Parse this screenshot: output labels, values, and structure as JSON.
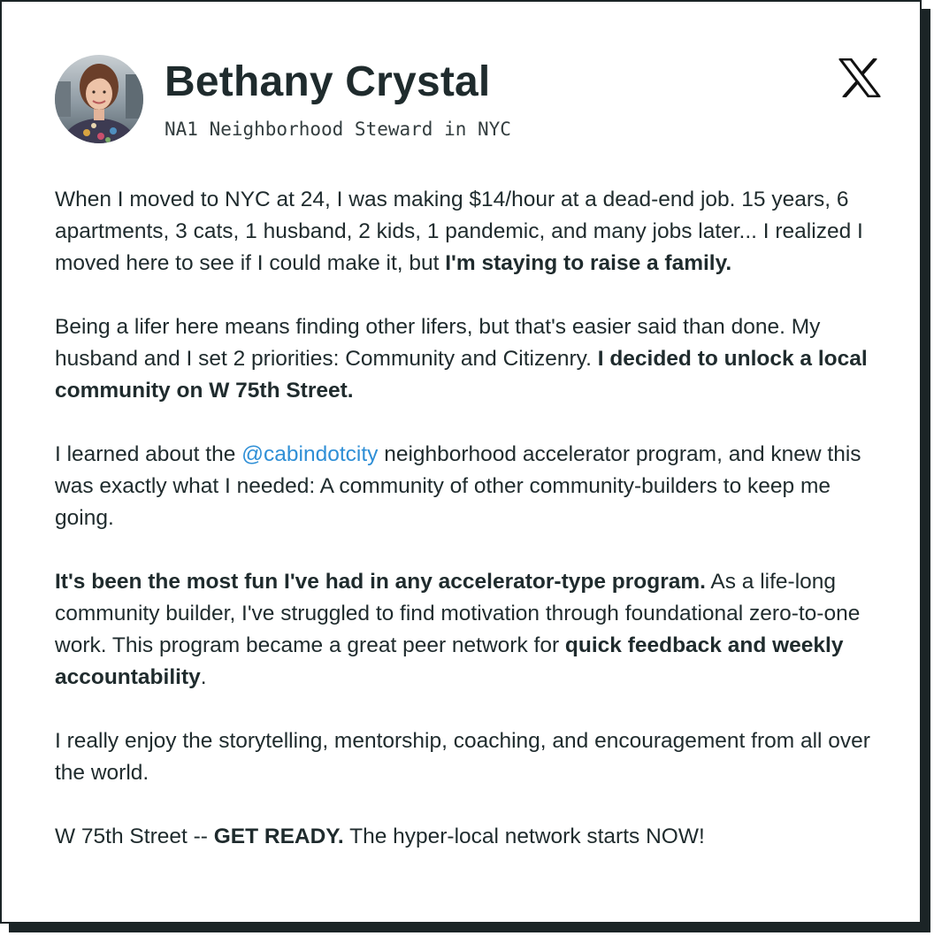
{
  "profile": {
    "name": "Bethany Crystal",
    "subtitle": "NA1 Neighborhood Steward in NYC",
    "avatar_icon": "profile-photo",
    "source_icon": "x-logo-icon"
  },
  "colors": {
    "text": "#1f2b2d",
    "mention": "#2f8fd6",
    "border": "#1b2426"
  },
  "testimonial": {
    "p1": {
      "t1": "When I moved to NYC at 24, I was making $14/hour at a dead-end job. 15 years, 6 apartments, 3 cats, 1 husband, 2 kids, 1 pandemic, and many jobs later... I realized I moved here to see if I could make it, but ",
      "b1": "I'm staying to raise a family."
    },
    "p2": {
      "t1": "Being a lifer here means finding other lifers, but that's easier said than done. My husband and I set 2 priorities: Community and Citizenry. ",
      "b1": "I decided to unlock a local community on W 75th Street."
    },
    "p3": {
      "t1": "I learned about the ",
      "mention": "@cabindotcity",
      "t2": " neighborhood accelerator program, and knew this was exactly what I needed: A community of other community-builders to keep me going."
    },
    "p4": {
      "b1": "It's been the most fun I've had in any accelerator-type program.",
      "t1": " As a life-long community builder, I've struggled to find motivation through foundational zero-to-one work. This program became a great peer network for ",
      "b2": "quick feedback and weekly accountability",
      "t2": "."
    },
    "p5": {
      "t1": "I really enjoy the storytelling, mentorship, coaching, and encouragement from all over the world."
    },
    "p6": {
      "t1": "W 75th Street -- ",
      "b1": "GET READY.",
      "t2": " The hyper-local network starts NOW!"
    }
  }
}
